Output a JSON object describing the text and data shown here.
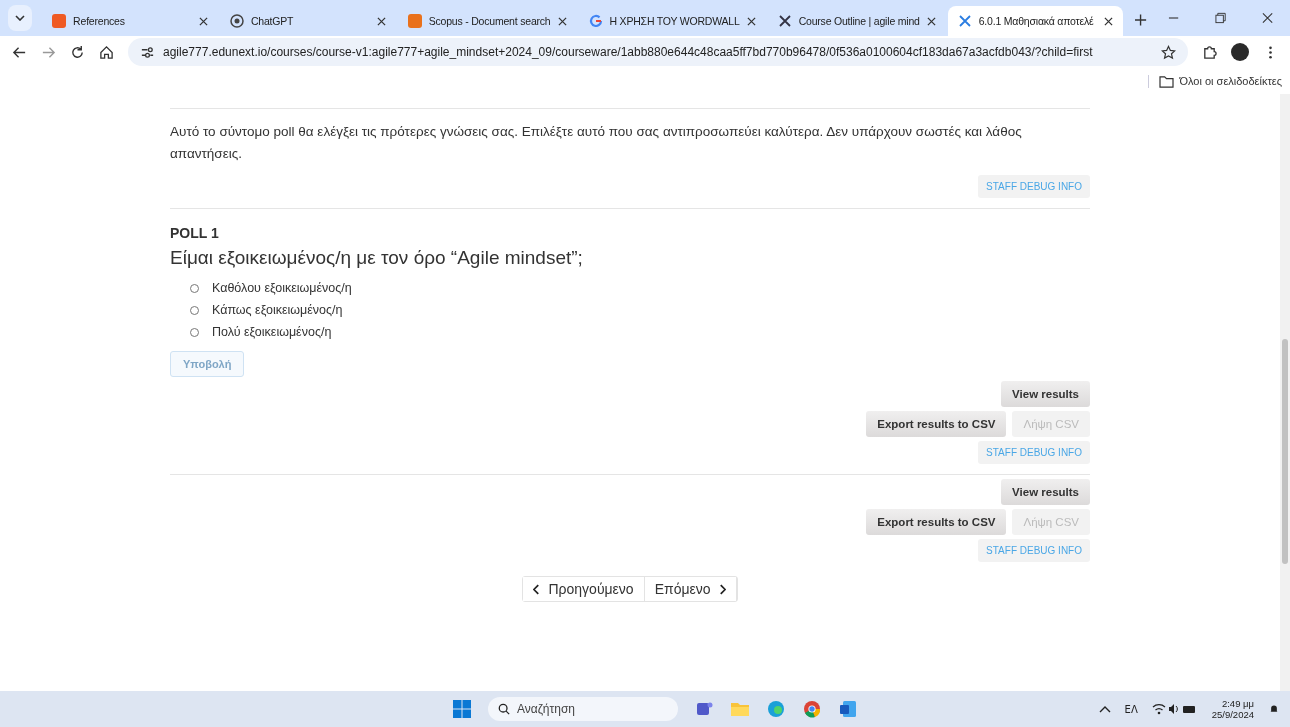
{
  "tabs": [
    {
      "title": "References",
      "kind": "orange",
      "selected": false
    },
    {
      "title": "ChatGPT",
      "kind": "gpt",
      "selected": false
    },
    {
      "title": "Scopus - Document search",
      "kind": "sc",
      "selected": false
    },
    {
      "title": "Η ΧΡΗΣΗ ΤΟΥ WORDWALL",
      "kind": "g",
      "selected": false
    },
    {
      "title": "Course Outline | agile mind",
      "kind": "x",
      "selected": false
    },
    {
      "title": "6.0.1 Μαθησιακά αποτελέ",
      "kind": "x",
      "selected": true
    }
  ],
  "address": "agile777.edunext.io/courses/course-v1:agile777+agile_mindset+2024_09/courseware/1abb880e644c48caa5ff7bd770b96478/0f536a0100604cf183da67a3acfdb043/?child=first",
  "bookmarks_label": "Όλοι οι σελιδοδείκτες",
  "intro": "Αυτό το σύντομο poll θα ελέγξει τις πρότερες γνώσεις σας. Επιλέξτε αυτό που σας αντιπροσωπεύει καλύτερα. Δεν υπάρχουν σωστές και λάθος απαντήσεις.",
  "debug_label": "STAFF DEBUG INFO",
  "poll": {
    "heading": "POLL 1",
    "question": "Είμαι εξοικειωμένος/η με τον όρο “Agile mindset”;",
    "options": [
      {
        "label": "Καθόλου εξοικειωμένος/η",
        "selected": false
      },
      {
        "label": "Κάπως εξοικειωμένος/η",
        "selected": false
      },
      {
        "label": "Πολύ εξοικειωμένος/η",
        "selected": false
      }
    ],
    "submit": {
      "label": "Υποβολή",
      "disabled": true
    }
  },
  "result_blocks": [
    {
      "view": "View results",
      "export": "Export results to CSV",
      "download": "Λήψη CSV",
      "download_disabled": true,
      "debug": "STAFF DEBUG INFO"
    },
    {
      "view": "View results",
      "export": "Export results to CSV",
      "download": "Λήψη CSV",
      "download_disabled": true,
      "debug": "STAFF DEBUG INFO"
    }
  ],
  "nav": {
    "previous": "Προηγούμενο",
    "next": "Επόμενο"
  },
  "taskbar": {
    "search_placeholder": "Αναζήτηση",
    "language": "ΕΛ",
    "time": "2:49 μμ",
    "date": "25/9/2024"
  }
}
